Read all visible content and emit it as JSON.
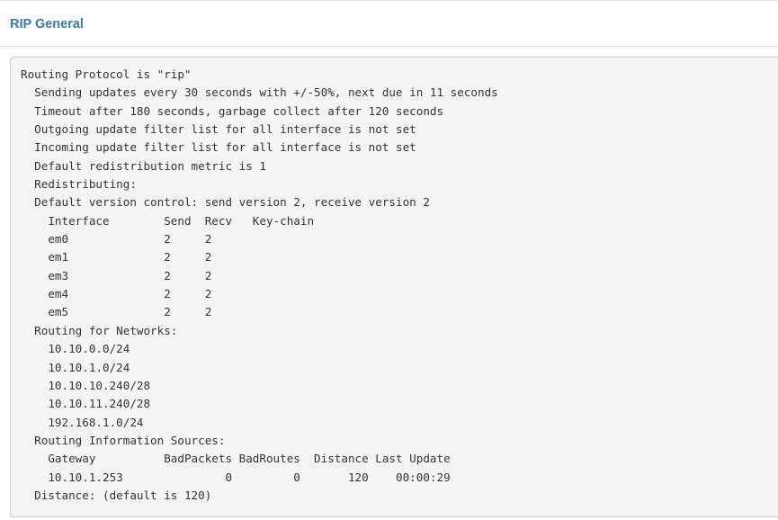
{
  "panel": {
    "title": "RIP General"
  },
  "output": {
    "lines": [
      "Routing Protocol is \"rip\"",
      "  Sending updates every 30 seconds with +/-50%, next due in 11 seconds",
      "  Timeout after 180 seconds, garbage collect after 120 seconds",
      "  Outgoing update filter list for all interface is not set",
      "  Incoming update filter list for all interface is not set",
      "  Default redistribution metric is 1",
      "  Redistributing:",
      "  Default version control: send version 2, receive version 2",
      "    Interface        Send  Recv   Key-chain",
      "    em0              2     2",
      "    em1              2     2",
      "    em3              2     2",
      "    em4              2     2",
      "    em5              2     2",
      "  Routing for Networks:",
      "    10.10.0.0/24",
      "    10.10.1.0/24",
      "    10.10.10.240/28",
      "    10.10.11.240/28",
      "    192.168.1.0/24",
      "  Routing Information Sources:",
      "    Gateway          BadPackets BadRoutes  Distance Last Update",
      "    10.10.1.253               0         0       120    00:00:29",
      "  Distance: (default is 120)"
    ]
  }
}
